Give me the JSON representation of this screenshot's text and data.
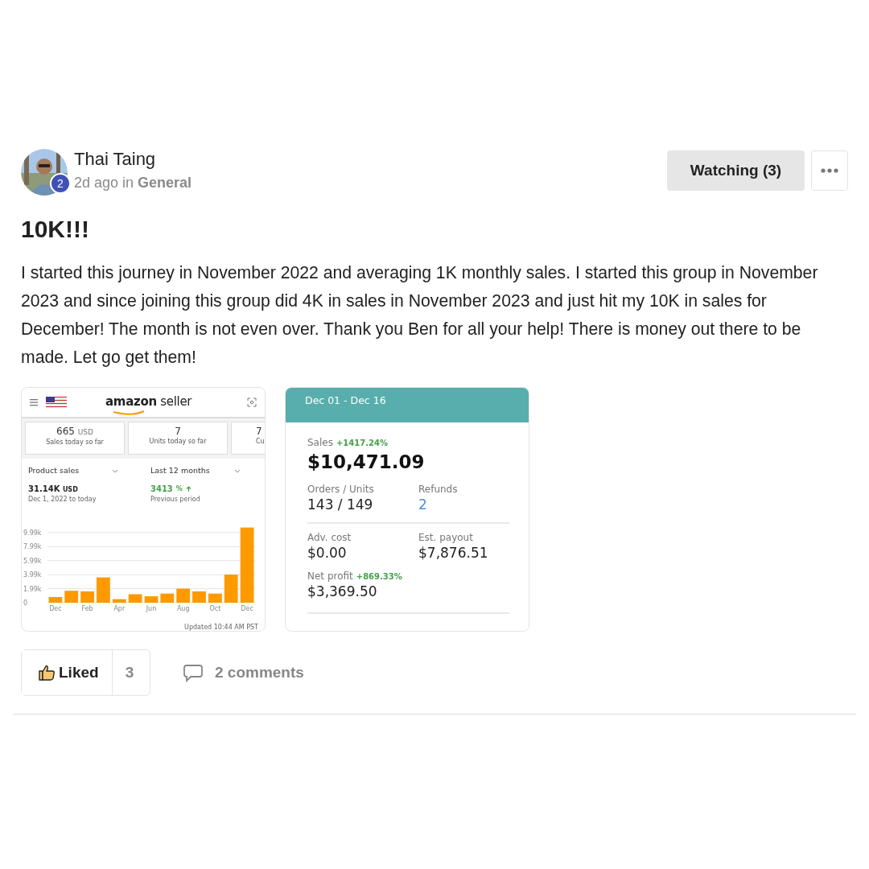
{
  "post": {
    "author": {
      "name": "Thai Taing",
      "level": "2"
    },
    "meta": "2d ago in **General**",
    "watch_button": "Watching (3)",
    "title": "10K!!!",
    "body": "I started this journey in November 2022 and averaging 1K monthly sales. I started this group in November 2023 and since joining this group did 4K in sales in November 2023 and just hit my 10K in sales for December! The month is not even over. Thank you Ben for all your help! There is money out there to be made. Let go get them!",
    "attachments": [
      {
        "kind": "amazon_seller",
        "logo": "**amazon** seller",
        "tiles": [
          {
            "value": "665",
            "unit": "USD",
            "label": "Sales today so far"
          },
          {
            "value": "7",
            "label": "Units today so far"
          },
          {
            "value": "7",
            "label": "Cu"
          }
        ],
        "metric_select": "Product sales",
        "period_select": "Last 12 months",
        "total": "31.14K",
        "total_unit": "USD",
        "total_note": "Dec 1, 2022 to today",
        "change": "3413",
        "change_unit": "%",
        "change_note": "Previous period",
        "chart_data": {
          "type": "bar",
          "categories": [
            "Dec",
            null,
            "Feb",
            null,
            "Apr",
            null,
            "Jun",
            null,
            "Aug",
            null,
            "Oct",
            null,
            "Dec"
          ],
          "values": [
            800,
            1700,
            1600,
            3600,
            500,
            1200,
            900,
            1300,
            2000,
            1600,
            1300,
            4000,
            10700
          ],
          "ylim": [
            0,
            11000
          ],
          "grid": true,
          "yticks": [
            {
              "value": 0,
              "label": "0"
            },
            {
              "value": 1990,
              "label": "1.99k"
            },
            {
              "value": 3990,
              "label": "3.99k"
            },
            {
              "value": 5990,
              "label": "5.99k"
            },
            {
              "value": 7990,
              "label": "7.99k"
            },
            {
              "value": 9990,
              "label": "9.99k"
            }
          ]
        },
        "updated": "Updated 10:44 AM PST"
      },
      {
        "kind": "metrics",
        "date_range": "Dec 01 - Dec 16",
        "sales_label": "Sales",
        "sales_change": "+1417.24%",
        "sales": "$10,471.09",
        "stat_groups": [
          [
            {
              "label": "Orders / Units",
              "value": "143 / 149",
              "highlight": false
            },
            {
              "label": "Refunds",
              "value": "2",
              "highlight": true
            }
          ],
          [
            {
              "label": "Adv. cost",
              "value": "$0.00",
              "highlight": false
            },
            {
              "label": "Est. payout",
              "value": "$7,876.51",
              "highlight": false
            }
          ]
        ],
        "net_label": "Net profit",
        "net_change": "+869.33%",
        "net": "$3,369.50"
      }
    ],
    "like": {
      "label": "Liked",
      "count": "3",
      "liked": true
    },
    "comments": "2 comments"
  }
}
